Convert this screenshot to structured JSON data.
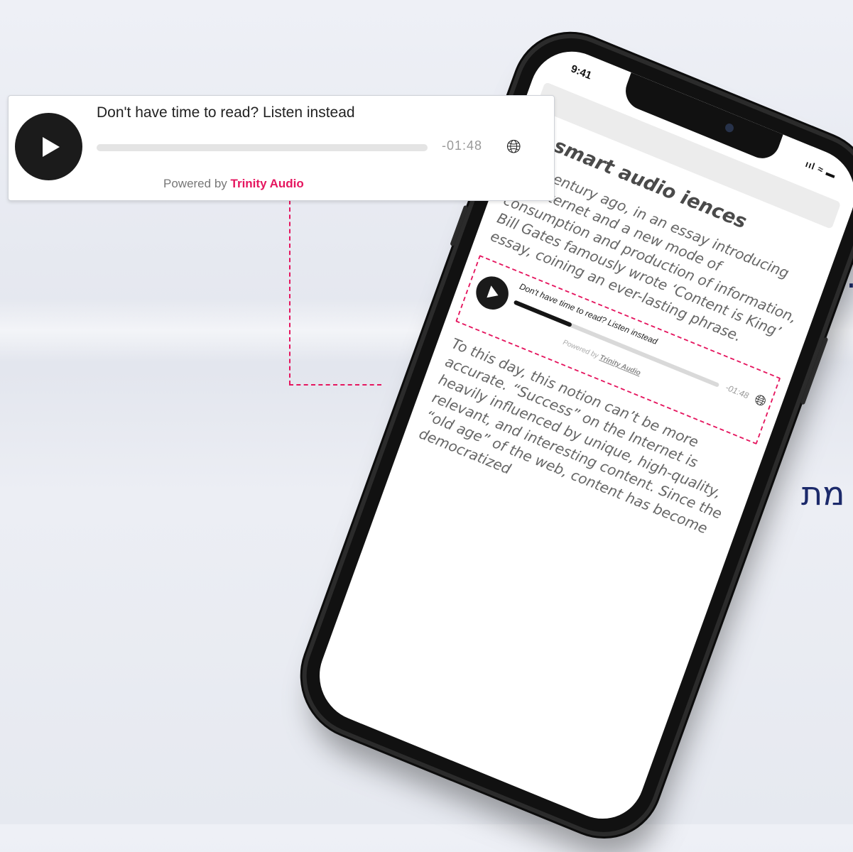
{
  "widget": {
    "title": "Don't have time to read? Listen instead",
    "time": "-01:48",
    "powered_prefix": "Powered by",
    "powered_brand": "Trinity Audio",
    "progress": 0.0
  },
  "phone": {
    "status_time": "9:41",
    "status_icons": "ııl ≈ ▬",
    "article": {
      "heading": "te smart audio iences",
      "paragraph1": "of a century ago, in an essay introducing the internet and a new mode of consumption and production of information, Bill Gates famously wrote ‘Content is King’ essay, coining an ever-lasting phrase.",
      "paragraph2": "To this day, this notion can’t be more accurate. “Success” on the Internet is heavily influenced by unique, high-quality, relevant, and interesting content. Since the “old age” of the web, content has become democratized"
    },
    "mini_player": {
      "title": "Don't have time to read? Listen instead",
      "time": "-01:48",
      "powered_prefix": "Powered by",
      "powered_brand": "Trinity Audio",
      "progress": 0.28
    }
  },
  "background": {
    "fragment_top": "ד.",
    "fragment_bottom": "מת"
  },
  "colors": {
    "accent": "#e5165f",
    "heading_text": "#1c2a6b"
  }
}
